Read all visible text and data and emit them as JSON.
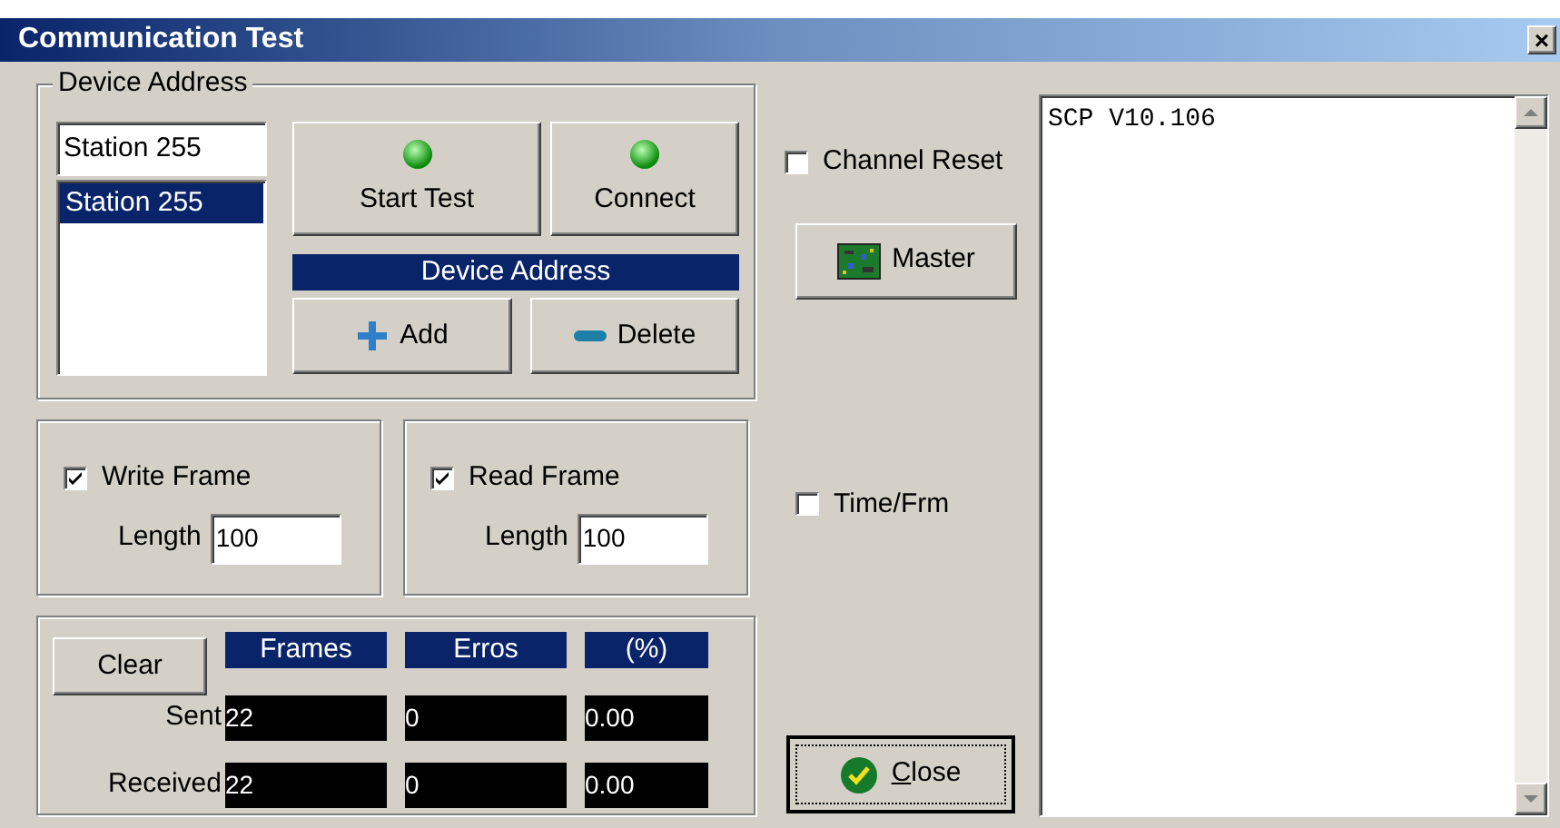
{
  "window": {
    "title": "Communication Test",
    "close_label": "×"
  },
  "device_address": {
    "legend": "Device Address",
    "input_value": "Station 255",
    "stations": [
      {
        "label": "Station 255",
        "selected": true
      }
    ],
    "led_buttons": [
      {
        "label": "Start Test",
        "lit": true
      },
      {
        "label": "Connect",
        "lit": true
      }
    ],
    "header": "Device Address",
    "actions": [
      {
        "label": "Add",
        "kind": "add"
      },
      {
        "label": "Delete",
        "kind": "delete"
      }
    ]
  },
  "frames": [
    {
      "label": "Write Frame",
      "checked": true,
      "length_label": "Length",
      "length": "100"
    },
    {
      "label": "Read Frame",
      "checked": true,
      "length_label": "Length",
      "length": "100"
    }
  ],
  "stats": {
    "clear": "Clear",
    "columns": [
      "Frames",
      "Erros",
      "(%)"
    ],
    "rows": [
      {
        "label": "Sent",
        "cells": [
          "22",
          "0",
          "0.00"
        ]
      },
      {
        "label": "Received",
        "cells": [
          "22",
          "0",
          "0.00"
        ]
      }
    ]
  },
  "options": [
    {
      "label": "Channel Reset",
      "checked": false
    },
    {
      "label": "Time/Frm",
      "checked": false
    }
  ],
  "master_button": "Master",
  "close_button": {
    "label": "Close",
    "underline_first": true
  },
  "log": {
    "text": "SCP V10.106"
  }
}
